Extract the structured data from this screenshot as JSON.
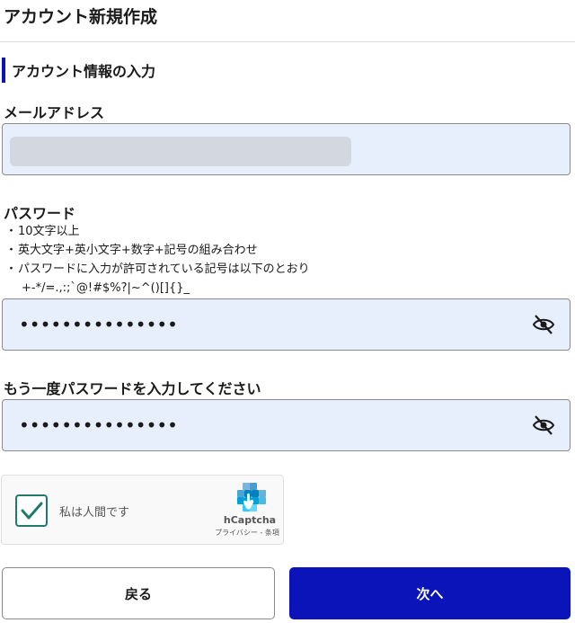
{
  "header": {
    "title": "アカウント新規作成"
  },
  "section": {
    "heading": "アカウント情報の入力"
  },
  "email": {
    "label": "メールアドレス",
    "value": ""
  },
  "password": {
    "label": "パスワード",
    "value": "•••••••••••••••",
    "rules": [
      "10文字以上",
      "英大文字+英小文字+数字+記号の組み合わせ",
      "パスワードに入力が許可されている記号は以下のとおり"
    ],
    "bullet": "・",
    "allowed_symbols": "+-*/=.,:;`@!#$%?|~^()[]{}_",
    "toggle_icon": "eye-slash-icon"
  },
  "password_confirm": {
    "label": "もう一度パスワードを入力してください",
    "value": "•••••••••••••••",
    "toggle_icon": "eye-slash-icon"
  },
  "captcha": {
    "checked": true,
    "label": "私は人間です",
    "brand": "hCaptcha",
    "links": "プライバシー - 条項"
  },
  "buttons": {
    "back_label": "戻る",
    "next_label": "次へ"
  },
  "colors": {
    "primary": "#0a14b8",
    "input_bg": "#e7eefc",
    "check": "#1f7a6c"
  }
}
